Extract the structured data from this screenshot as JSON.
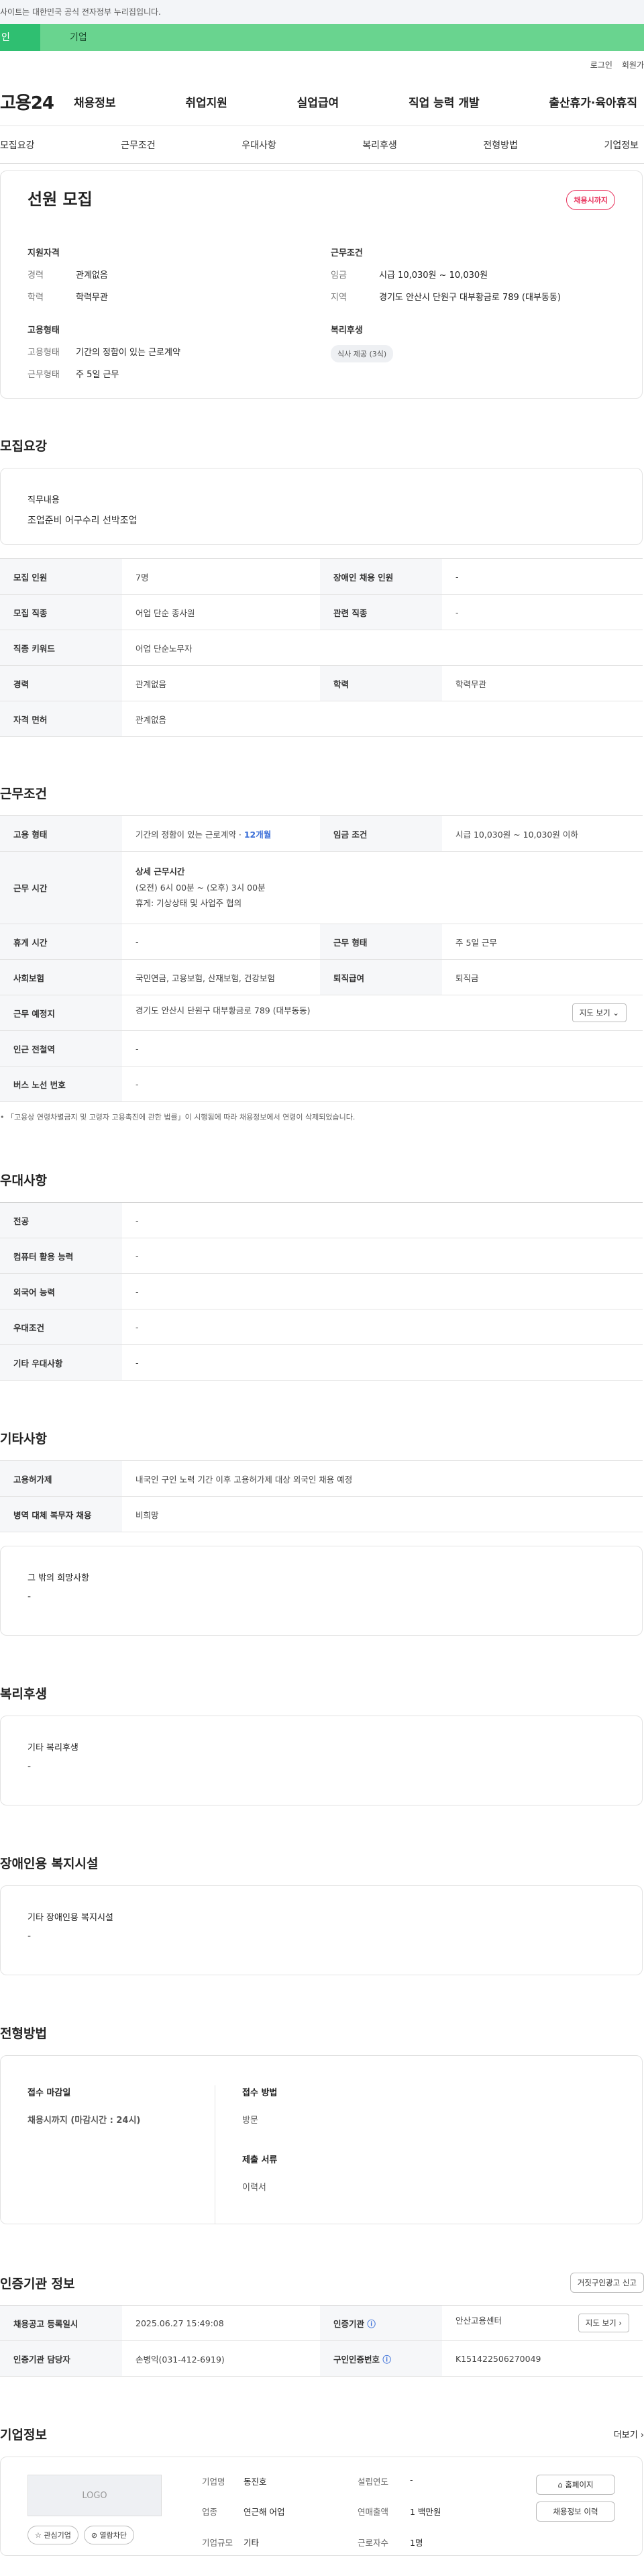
{
  "topbar": {
    "notice": "사이트는 대한민국 공식 전자정부 누리집입니다."
  },
  "user_tabs": {
    "personal": "인",
    "company": "기업"
  },
  "util": {
    "login": "로그인",
    "join": "회원가"
  },
  "gnb": {
    "logo": "고용24",
    "menu": [
      "채용정보",
      "취업지원",
      "실업급여",
      "직업 능력 개발",
      "출산휴가·육아휴직"
    ]
  },
  "subtabs": [
    "모집요강",
    "근무조건",
    "우대사항",
    "복리후생",
    "전형방법",
    "기업정보"
  ],
  "hero": {
    "title": "선원 모집",
    "badge": "채용시까지",
    "qual": {
      "heading": "지원자격",
      "career_k": "경력",
      "career_v": "관계없음",
      "edu_k": "학력",
      "edu_v": "학력무관"
    },
    "cond": {
      "heading": "근무조건",
      "wage_k": "임금",
      "wage_v": "시급 10,030원 ~ 10,030원",
      "region_k": "지역",
      "region_v": "경기도 안산시 단원구 대부황금로 789 (대부동동)"
    },
    "employ": {
      "heading": "고용형태",
      "type_k": "고용형태",
      "type_v": "기간의 정함이 있는 근로계약",
      "shift_k": "근무형태",
      "shift_v": "주 5일 근무"
    },
    "welfare": {
      "heading": "복리후생",
      "chip": "식사 제공 (3식)"
    }
  },
  "recruit": {
    "title": "모집요강",
    "job_label": "직무내용",
    "job_value": "조업준비 어구수리 선박조업",
    "rows": [
      [
        "모집 인원",
        "7명",
        "장애인 채용 인원",
        "-"
      ],
      [
        "모집 직종",
        "어업 단순 종사원",
        "관련 직종",
        "-"
      ],
      [
        "직종 키워드",
        "어업 단순노무자"
      ],
      [
        "경력",
        "관계없음",
        "학력",
        "학력무관"
      ],
      [
        "자격 면허",
        "관계없음"
      ]
    ]
  },
  "workcond": {
    "title": "근무조건",
    "emp_type_k": "고용 형태",
    "emp_type_v": "기간의 정함이 있는 근로계약 · ",
    "emp_type_hl": "12개월",
    "wage_k": "임금 조건",
    "wage_v": "시급 10,030원 ~ 10,030원 이하",
    "time_k": "근무 시간",
    "time_title": "상세 근무시간",
    "time_l1": "(오전) 6시 00분 ~ (오후) 3시 00분",
    "time_l2": "휴게: 기상상태 및 사업주 협의",
    "rest_k": "휴게 시간",
    "rest_v": "-",
    "shift_k": "근무 형태",
    "shift_v": "주 5일 근무",
    "ins_k": "사회보험",
    "ins_v": "국민연금, 고용보험, 산재보험, 건강보험",
    "sev_k": "퇴직급여",
    "sev_v": "퇴직금",
    "place_k": "근무 예정지",
    "place_v": "경기도 안산시 단원구 대부황금로 789 (대부동동)",
    "map_btn": "지도 보기 ⌄",
    "subway_k": "인근 전철역",
    "subway_v": "-",
    "bus_k": "버스 노선 번호",
    "bus_v": "-",
    "note": "「고용상 연령차별금지 및 고령자 고용촉진에 관한 법률」이 시행됨에 따라 채용정보에서 연령이 삭제되었습니다."
  },
  "pref": {
    "title": "우대사항",
    "rows": [
      [
        "전공",
        "-"
      ],
      [
        "컴퓨터 활용 능력",
        "-"
      ],
      [
        "외국어 능력",
        "-"
      ],
      [
        "우대조건",
        "-"
      ],
      [
        "기타 우대사항",
        "-"
      ]
    ]
  },
  "etc": {
    "title": "기타사항",
    "rows": [
      [
        "고용허가제",
        "내국인 구인 노력 기간 이후 고용허가제 대상 외국인 채용 예정"
      ],
      [
        "병역 대체 복무자 채용",
        "비희망"
      ]
    ],
    "box_label": "그 밖의 희망사항",
    "box_value": "-"
  },
  "welfare": {
    "title": "복리후생",
    "label": "기타 복리후생",
    "value": "-"
  },
  "disab": {
    "title": "장애인용 복지시설",
    "label": "기타 장애인용 복지시설",
    "value": "-"
  },
  "process": {
    "title": "전형방법",
    "deadline_k": "접수 마감일",
    "deadline_v": "채용시까지 (마감시간 : 24시)",
    "method_k": "접수 방법",
    "method_v": "방문",
    "docs_k": "제출 서류",
    "docs_v": "이력서"
  },
  "agency": {
    "title": "인증기관 정보",
    "fake_btn": "거짓구인광고 신고",
    "reg_k": "채용공고 등록일시",
    "reg_v": "2025.06.27 15:49:08",
    "org_k": "인증기관",
    "org_v": "안산고용센터",
    "map_btn": "지도 보기 ›",
    "mgr_k": "인증기관 담당자",
    "mgr_v": "손병익(031-412-6919)",
    "cert_k": "구인인증번호",
    "cert_v": "K151422506270049"
  },
  "company": {
    "title": "기업정보",
    "more": "더보기 ›",
    "logo": "LOGO",
    "interest": "☆ 관심기업",
    "block": "⊘ 열람차단",
    "name_k": "기업명",
    "name_v": "동진호",
    "year_k": "설립연도",
    "year_v": "-",
    "ind_k": "업종",
    "ind_v": "연근해 어업",
    "sales_k": "연매출액",
    "sales_v": "1 백만원",
    "size_k": "기업규모",
    "size_v": "기타",
    "emp_k": "근로자수",
    "emp_v": "1명",
    "homepage": "⌂ 홈페이지",
    "history": "채용정보 이력"
  }
}
